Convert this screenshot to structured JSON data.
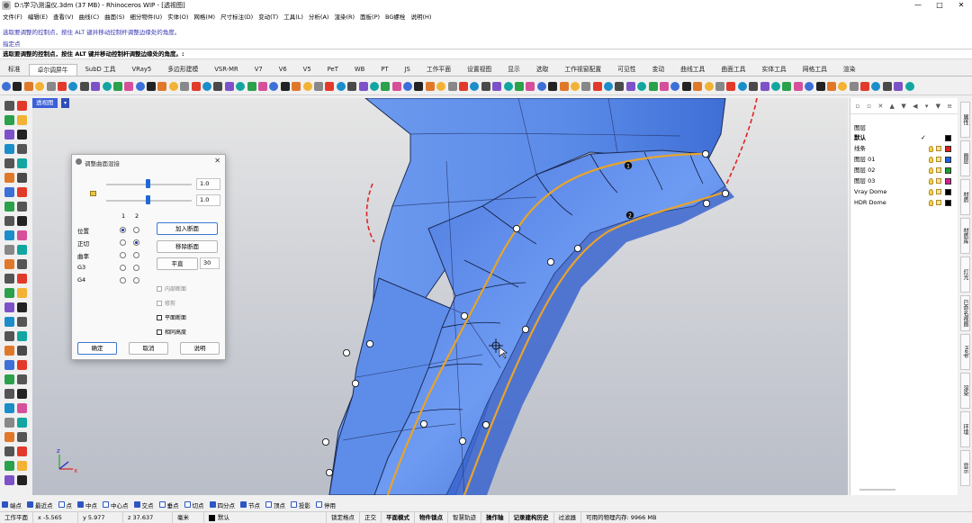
{
  "window": {
    "title": "D:\\学习\\测温仪.3dm (37 MB) - Rhinoceros WIP - [透视图]",
    "minimize": "—",
    "maximize": "□",
    "close": "✕"
  },
  "menubar": [
    "文件(F)",
    "编辑(E)",
    "查看(V)",
    "曲线(C)",
    "曲面(S)",
    "细分物件(U)",
    "实体(O)",
    "网格(M)",
    "尺寸标注(D)",
    "变动(T)",
    "工具(L)",
    "分析(A)",
    "渲染(R)",
    "面板(P)",
    "BG螺栓",
    "说明(H)"
  ],
  "command": {
    "history_line1": "选取要调整的控制点，按住 ALT 键并移动控制杆调整边缘处的角度。",
    "history_line2": "指定点",
    "prompt": "选取要调整的控制点，按住 ALT 键并移动控制杆调整边缘处的角度。:"
  },
  "tabs": [
    "标准",
    "卓尔调屏牛",
    "SubD 工具",
    "VRay5",
    "多边形建模",
    "VSR-MR",
    "V7",
    "V6",
    "V5",
    "PeT",
    "WB",
    "PT",
    "JS",
    "工作平面",
    "设置视图",
    "显示",
    "选取",
    "工作视窗配置",
    "可见性",
    "变动",
    "曲线工具",
    "曲面工具",
    "实体工具",
    "网格工具",
    "渲染"
  ],
  "active_tab_index": 1,
  "viewport": {
    "name": "透视图",
    "axis_x": "x",
    "axis_y": "y",
    "axis_z": "z",
    "point_labels": [
      "1",
      "2"
    ]
  },
  "dialog": {
    "title": "调整曲面混接",
    "slider1_value": "1.0",
    "slider2_value": "1.0",
    "col1": "1",
    "col2": "2",
    "rows": [
      {
        "label": "位置",
        "r1": true,
        "r2": false
      },
      {
        "label": "正切",
        "r1": false,
        "r2": true
      },
      {
        "label": "曲率",
        "r1": false,
        "r2": false
      },
      {
        "label": "G3",
        "r1": false,
        "r2": false
      },
      {
        "label": "G4",
        "r1": false,
        "r2": false
      }
    ],
    "add_section": "加入断面",
    "remove_section": "移除断面",
    "planar": "平直",
    "planar_value": "30",
    "inner_section": "内部断面",
    "trim": "修剪",
    "planar_section": "平面断面",
    "same_height": "相同高度",
    "ok": "确定",
    "cancel": "取消",
    "help": "说明"
  },
  "layers": {
    "header": "图层",
    "items": [
      {
        "name": "默认",
        "bold": true,
        "current": "✓",
        "color": "#000000"
      },
      {
        "name": "线条",
        "bold": false,
        "current": "",
        "color": "#e11d1d"
      },
      {
        "name": "图层 01",
        "bold": false,
        "current": "",
        "color": "#1d63e1"
      },
      {
        "name": "图层 02",
        "bold": false,
        "current": "",
        "color": "#1aa12c"
      },
      {
        "name": "图层 03",
        "bold": false,
        "current": "",
        "color": "#d21f8f"
      },
      {
        "name": "Vray Dome",
        "bold": false,
        "current": "",
        "color": "#000000"
      },
      {
        "name": "HDR Dome",
        "bold": false,
        "current": "",
        "color": "#000000"
      }
    ]
  },
  "right_tabs": [
    "属性",
    "图层",
    "材质",
    "材质库",
    "灯光",
    "已命名视图",
    "Help",
    "渲染",
    "环境",
    "显示"
  ],
  "osnaps": [
    {
      "label": "端点",
      "on": true
    },
    {
      "label": "最近点",
      "on": true
    },
    {
      "label": "点",
      "on": false
    },
    {
      "label": "中点",
      "on": true
    },
    {
      "label": "中心点",
      "on": false
    },
    {
      "label": "交点",
      "on": true
    },
    {
      "label": "垂点",
      "on": false
    },
    {
      "label": "切点",
      "on": false
    },
    {
      "label": "四分点",
      "on": true
    },
    {
      "label": "节点",
      "on": true
    },
    {
      "label": "顶点",
      "on": false
    },
    {
      "label": "投影",
      "on": false
    },
    {
      "label": "停用",
      "on": false
    }
  ],
  "status": {
    "cplane": "工作平面",
    "x": "x -5.565",
    "y": "y 5.977",
    "z": "z 37.637",
    "unit": "毫米",
    "layer": "默认",
    "grid_snap": "锁定格点",
    "ortho": "正交",
    "planar": "平面模式",
    "osnap": "物件锁点",
    "smarttrack": "智慧轨迹",
    "gumball": "操作轴",
    "history": "记录建构历史",
    "filter": "过滤器",
    "memory": "可用的物理内存: 9966 MB"
  }
}
